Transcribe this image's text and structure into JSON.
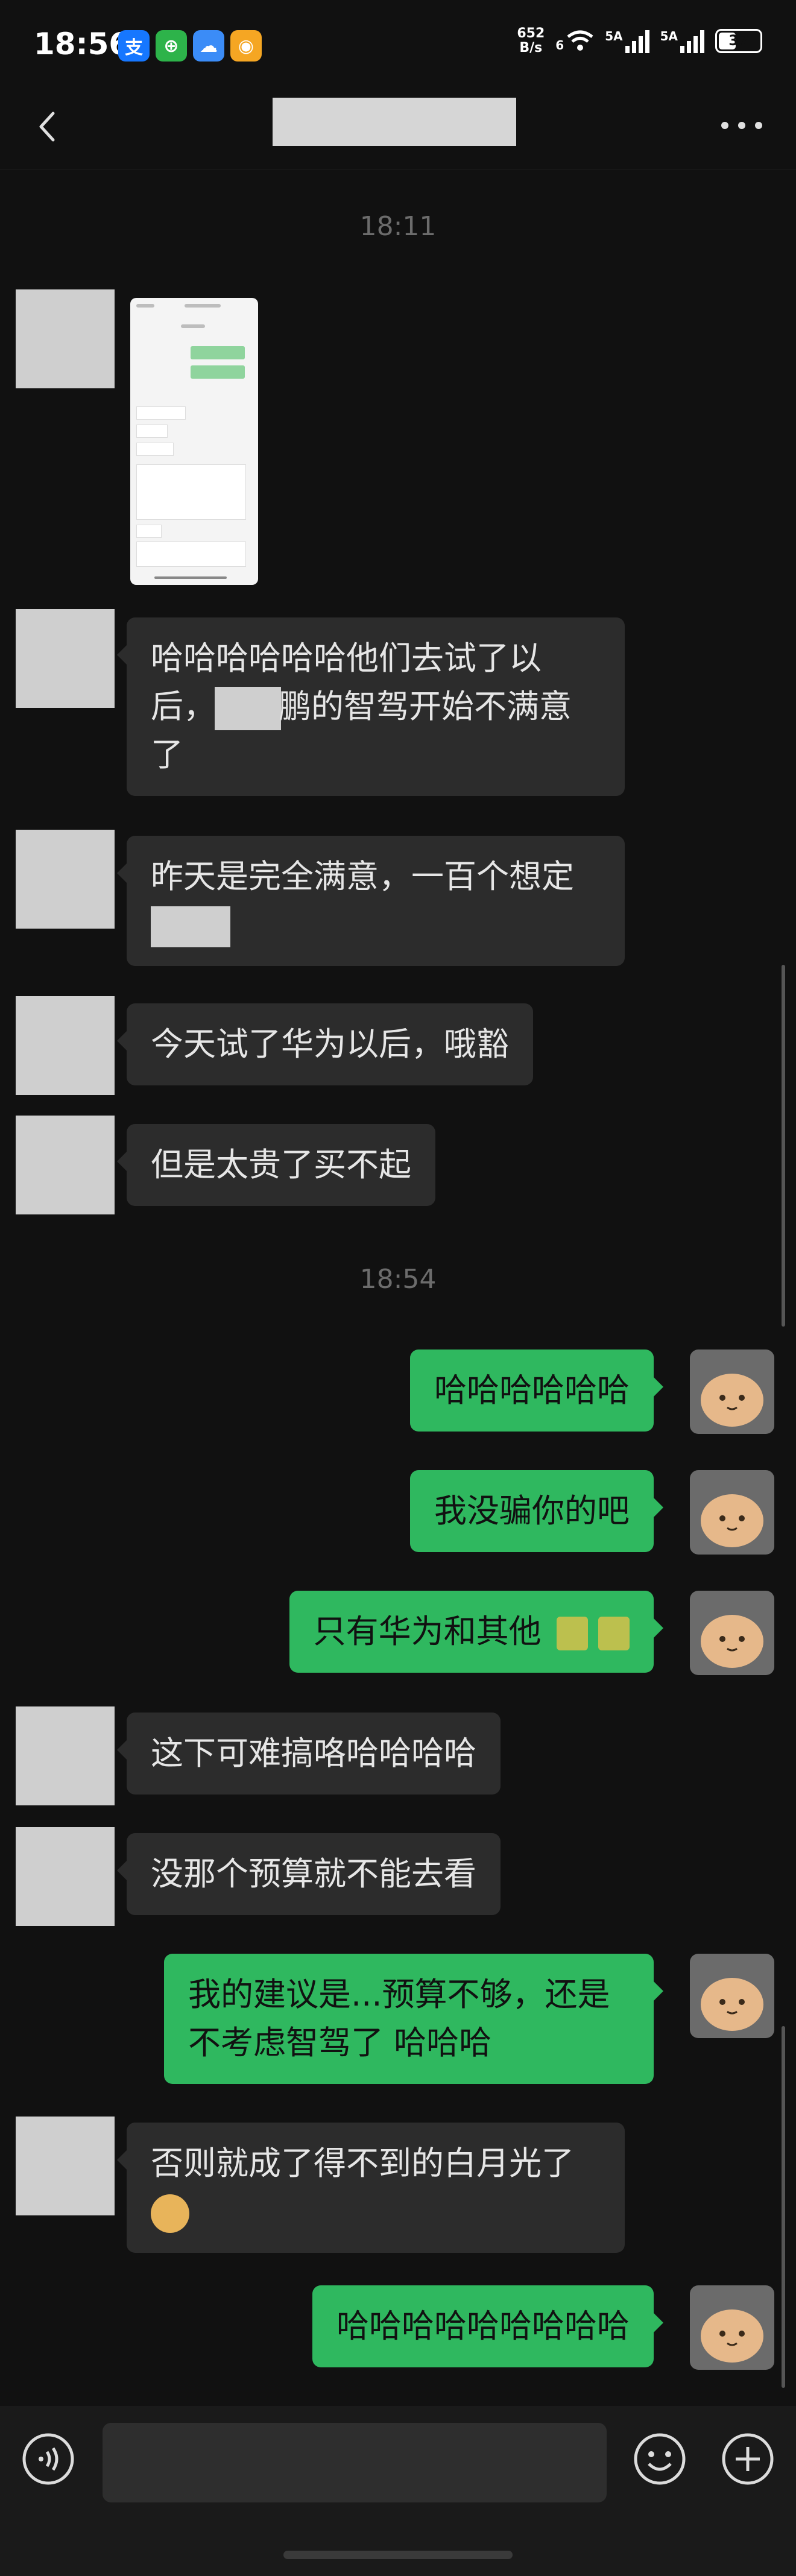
{
  "status_bar": {
    "time": "18:56",
    "net_speed_value": "652",
    "net_speed_unit": "B/s",
    "sig1": "5A",
    "sig2": "5A",
    "wifi": "6",
    "battery": "37"
  },
  "header": {
    "title": ""
  },
  "messages": {
    "ts1": "18:11",
    "m1_part1": "哈哈哈哈哈哈他们去试了以后，对",
    "m1_part2": "鹏的智驾开始不满意了",
    "m2": "昨天是完全满意，一百个想定",
    "m3": "今天试了华为以后，哦豁",
    "m4": "但是太贵了买不起",
    "ts2": "18:54",
    "m5": "哈哈哈哈哈哈",
    "m6": "我没骗你的吧",
    "m7": "只有华为和其他",
    "m8": "这下可难搞咯哈哈哈哈",
    "m9": "没那个预算就不能去看",
    "m10": "我的建议是...预算不够，还是不考虑智驾了 哈哈哈",
    "m11": "否则就成了得不到的白月光了",
    "m12": "哈哈哈哈哈哈哈哈哈"
  },
  "input": {
    "placeholder": ""
  },
  "colors": {
    "bg": "#111111",
    "bubble_in": "#2c2c2c",
    "bubble_out": "#2fb85f"
  }
}
